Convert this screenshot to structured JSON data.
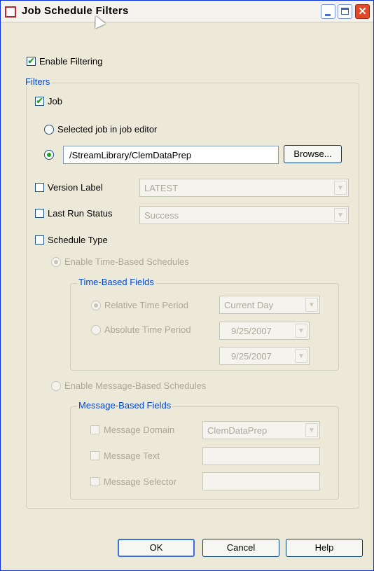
{
  "window": {
    "title": "Job Schedule Filters",
    "close_glyph": "✕"
  },
  "enable_filtering": {
    "label": "Enable Filtering",
    "checked": true
  },
  "filters": {
    "legend": "Filters",
    "job": {
      "label": "Job",
      "checked": true
    },
    "selected_job_option": {
      "label": "Selected job in job editor",
      "selected": false
    },
    "path_option": {
      "selected": true,
      "value": "/StreamLibrary/ClemDataPrep"
    },
    "browse_label": "Browse...",
    "version_label": {
      "label": "Version Label",
      "checked": false,
      "value": "LATEST"
    },
    "last_run_status": {
      "label": "Last Run Status",
      "checked": false,
      "value": "Success"
    },
    "schedule_type": {
      "label": "Schedule Type",
      "checked": false
    },
    "time_based": {
      "radio_label": "Enable Time-Based Schedules",
      "legend": "Time-Based Fields",
      "relative": {
        "label": "Relative Time Period",
        "value": "Current Day"
      },
      "absolute": {
        "label": "Absolute Time Period",
        "from": "9/25/2007",
        "to": "9/25/2007"
      }
    },
    "message_based": {
      "radio_label": "Enable Message-Based Schedules",
      "legend": "Message-Based Fields",
      "domain": {
        "label": "Message Domain",
        "value": "ClemDataPrep"
      },
      "text": {
        "label": "Message Text",
        "value": ""
      },
      "selector": {
        "label": "Message Selector",
        "value": ""
      }
    }
  },
  "buttons": {
    "ok": "OK",
    "cancel": "Cancel",
    "help": "Help"
  },
  "icons": {
    "check_mark": "✔",
    "dropdown_arrow": "▼"
  }
}
